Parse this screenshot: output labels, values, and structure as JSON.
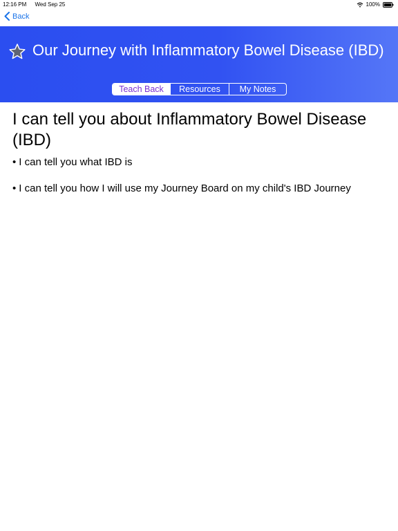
{
  "status_bar": {
    "time": "12:16 PM",
    "date": "Wed Sep 25",
    "battery": "100%",
    "icons": [
      "wifi-icon",
      "battery-icon"
    ]
  },
  "nav": {
    "back_label": "Back",
    "accent_color": "#1a73e8"
  },
  "header": {
    "title": "Our Journey with Inflammatory Bowel Disease (IBD)",
    "icon": "star-icon",
    "gradient_colors": [
      "#2b4ef0",
      "#5576f7"
    ]
  },
  "tabs": [
    {
      "label": "Teach Back",
      "selected": true
    },
    {
      "label": "Resources",
      "selected": false
    },
    {
      "label": "My Notes",
      "selected": false
    }
  ],
  "content": {
    "heading": "I can tell you about Inflammatory Bowel Disease (IBD)",
    "bullet_marker": "•",
    "bullets": [
      "I can tell you what IBD is",
      "I can tell you how I will use my Journey Board on my child's IBD Journey"
    ]
  }
}
